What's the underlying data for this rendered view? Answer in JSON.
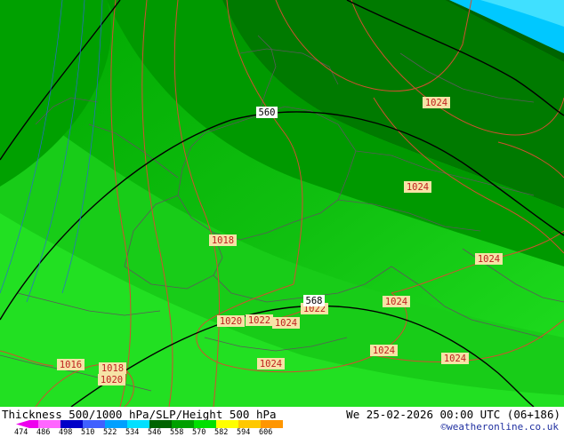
{
  "map": {
    "isobars_hpa": [
      {
        "label": "1024"
      },
      {
        "label": "1024"
      },
      {
        "label": "1018"
      },
      {
        "label": "1024"
      },
      {
        "label": "1024"
      },
      {
        "label": "1022"
      },
      {
        "label": "1020"
      },
      {
        "label": "1022"
      },
      {
        "label": "1024"
      },
      {
        "label": "1024"
      },
      {
        "label": "1016"
      },
      {
        "label": "1018"
      },
      {
        "label": "1020"
      },
      {
        "label": "1024"
      },
      {
        "label": "1024"
      }
    ],
    "height_contours": [
      {
        "label": "560"
      },
      {
        "label": "568"
      }
    ],
    "colors": {
      "isobar_line": "#d05030",
      "isobar_label_bg": "#f6e3a6",
      "isobar_label_text": "#c02020",
      "height_line": "#000000",
      "border_line": "#5a5a5a",
      "thickness_cold": "#00c8ff",
      "thickness_mid": "#00a000",
      "thickness_warm": "#20f020"
    }
  },
  "footer": {
    "title": "Thickness 500/1000 hPa/SLP/Height 500 hPa",
    "datetime": "We 25-02-2026 00:00 UTC (06+186)",
    "credit": "©weatheronline.co.uk",
    "scale": {
      "ticks": [
        "474",
        "486",
        "498",
        "510",
        "522",
        "534",
        "546",
        "558",
        "570",
        "582",
        "594",
        "606"
      ],
      "colors": [
        "#ee00ee",
        "#ff66ff",
        "#0000c8",
        "#4060ff",
        "#00a0ff",
        "#00e0ff",
        "#006400",
        "#00a000",
        "#00e000",
        "#ffff00",
        "#ffc800",
        "#ff9600"
      ]
    }
  }
}
